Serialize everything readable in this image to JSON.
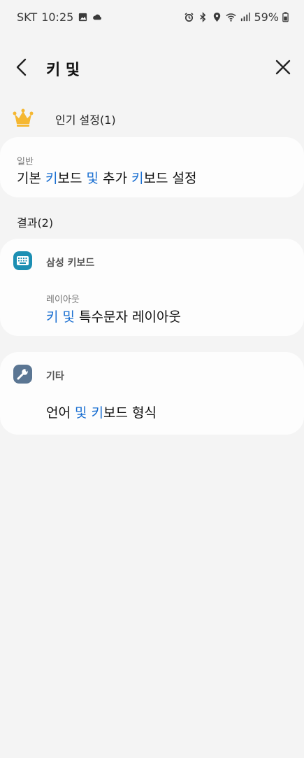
{
  "status": {
    "carrier": "SKT",
    "time": "10:25",
    "battery": "59%"
  },
  "header": {
    "title": "키 및"
  },
  "popular": {
    "label": "인기 설정(1)"
  },
  "card1": {
    "category": "일반",
    "text_parts": [
      "기본 ",
      "키",
      "보드 ",
      "및",
      " 추가 ",
      "키",
      "보드 설정"
    ]
  },
  "results": {
    "label": "결과(2)"
  },
  "card2": {
    "app_name": "삼성 키보드",
    "category": "레이아웃",
    "text_parts": [
      "키",
      " ",
      "및",
      " 특수문자 레이아웃"
    ]
  },
  "card3": {
    "app_name": "기타",
    "text_parts": [
      "언어 ",
      "및",
      " ",
      "키",
      "보드 형식"
    ]
  },
  "colors": {
    "highlight": "#1a6fd1",
    "samsung_keyboard_icon": "#1c8fb3",
    "other_icon": "#5b7693",
    "crown": "#f5b731"
  },
  "icons": {
    "back": "chevron-left-icon",
    "close": "close-icon",
    "crown": "crown-icon",
    "keyboard": "keyboard-icon",
    "wrench": "wrench-icon"
  }
}
